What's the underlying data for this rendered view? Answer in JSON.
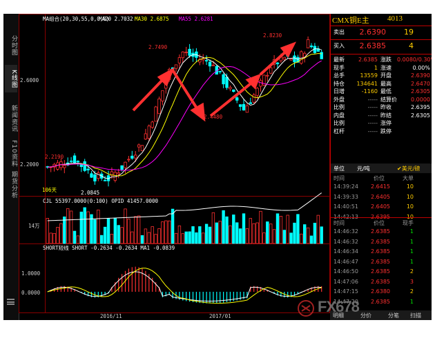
{
  "sidebar": {
    "tabs": [
      {
        "label": "分时图",
        "active": false
      },
      {
        "label": "K线图",
        "active": true
      },
      {
        "label": "新闻资讯",
        "active": false
      },
      {
        "label": "F10资料",
        "active": false
      },
      {
        "label": "期货分析",
        "active": false
      }
    ]
  },
  "main_chart": {
    "indicator_line": [
      "MA组合(20,30,55,0,0,0)",
      "MA20 2.7032",
      "MA30 2.6875",
      "MA55 2.6281"
    ],
    "indicator_colors": [
      "#ffffff",
      "#ffffff",
      "#ffff00",
      "#ff00ff"
    ],
    "price_labels": [
      "2.6000",
      "2.2000"
    ],
    "price_values": [
      2.6,
      2.2
    ],
    "annotations": [
      {
        "text": "2.8230",
        "price": 2.823
      },
      {
        "text": "2.7490",
        "price": 2.749
      },
      {
        "text": "2.2190",
        "price": 2.219
      },
      {
        "text": "2.0845",
        "price": 2.0845
      },
      {
        "text": "2.4480",
        "price": 2.448
      }
    ],
    "left_note": "106天",
    "y_range": [
      2.0,
      2.9
    ]
  },
  "volume_chart": {
    "header": "CJL 55397.0000(0:100)   OPID 41457.0000",
    "axis_label": "14万"
  },
  "short_chart": {
    "header": "SHORT短线  SHORT -0.2634      -0.2634   MA1  -0.0839",
    "axis_labels": [
      "1.0000",
      "0.0000"
    ],
    "y_values": [
      1.0,
      0.0
    ]
  },
  "x_axis": [
    "2016/11",
    "2017/01"
  ],
  "panel": {
    "title": "CMX铜E主",
    "code": "4013",
    "sell": {
      "label": "卖出",
      "price": "2.6390",
      "qty": "19"
    },
    "buy": {
      "label": "买入",
      "price": "2.6385",
      "qty": "4"
    },
    "quote_rows": [
      {
        "k1": "最新",
        "v1": "2.6385",
        "c1": "red",
        "k2": "涨跌",
        "v2": "0.0080/0.30%",
        "c2": "red"
      },
      {
        "k1": "现手",
        "v1": "1",
        "c1": "yel",
        "k2": "涨速",
        "v2": "0.00%",
        "c2": "wht"
      },
      {
        "k1": "总手",
        "v1": "13559",
        "c1": "yel",
        "k2": "开盘",
        "v2": "2.6390",
        "c2": "red"
      },
      {
        "k1": "持仓",
        "v1": "134641",
        "c1": "yel",
        "k2": "最高",
        "v2": "2.6470",
        "c2": "red"
      },
      {
        "k1": "日增",
        "v1": "-1160",
        "c1": "yel",
        "k2": "最低",
        "v2": "2.6305",
        "c2": "red"
      },
      {
        "k1": "外盘",
        "v1": "-----",
        "c1": "gry",
        "k2": "结算价",
        "v2": "0.0000",
        "c2": "red"
      },
      {
        "k1": "比例",
        "v1": "-----",
        "c1": "gry",
        "k2": "昨收",
        "v2": "2.6395",
        "c2": "wht"
      },
      {
        "k1": "内盘",
        "v1": "-----",
        "c1": "gry",
        "k2": "昨结",
        "v2": "2.6305",
        "c2": "wht"
      },
      {
        "k1": "比例",
        "v1": "-----",
        "c1": "gry",
        "k2": "涨停",
        "v2": "",
        "c2": "wht"
      },
      {
        "k1": "杠杆",
        "v1": "-----",
        "c1": "gry",
        "k2": "跌停",
        "v2": "",
        "c2": "wht"
      }
    ],
    "unit": {
      "label": "单位",
      "value": "元/吨",
      "check": "✔美元/磅"
    },
    "ticks_header": [
      "时间",
      "价位",
      "大单"
    ],
    "ticks": [
      {
        "time": "14:39:24",
        "price": "2.6415",
        "qty": "10"
      },
      {
        "time": "14:39:33",
        "price": "2.6405",
        "qty": "10"
      },
      {
        "time": "14:40:51",
        "price": "2.6405",
        "qty": "10"
      },
      {
        "time": "14:42:13",
        "price": "2.6395",
        "qty": "10"
      }
    ],
    "trades_header": [
      "时间",
      "价位",
      "现手"
    ],
    "trades": [
      {
        "time": "14:46:32",
        "price": "2.6385",
        "qty": "1"
      },
      {
        "time": "14:46:32",
        "price": "2.6385",
        "qty": "1"
      },
      {
        "time": "14:46:34",
        "price": "2.6385",
        "qty": "1"
      },
      {
        "time": "14:46:47",
        "price": "2.6385",
        "qty": "1"
      },
      {
        "time": "14:46:50",
        "price": "2.6385",
        "qty": "2"
      },
      {
        "time": "14:47:06",
        "price": "2.6385",
        "qty": "3"
      },
      {
        "time": "14:47:15",
        "price": "2.6380",
        "qty": "2"
      },
      {
        "time": "14:47:20",
        "price": "2.6385",
        "qty": "1"
      }
    ],
    "bottom_tabs": [
      "明细",
      "分价",
      "分笔",
      "扫描"
    ]
  },
  "watermark": "FX678"
}
